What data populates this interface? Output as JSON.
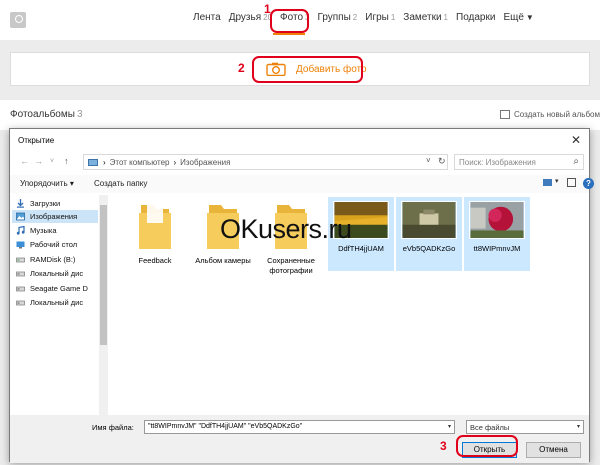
{
  "ok_page": {
    "nav": [
      {
        "label": "Лента",
        "count": ""
      },
      {
        "label": "Друзья",
        "count": "20"
      },
      {
        "label": "Фото",
        "count": "3"
      },
      {
        "label": "Группы",
        "count": "2"
      },
      {
        "label": "Игры",
        "count": "1"
      },
      {
        "label": "Заметки",
        "count": "1"
      },
      {
        "label": "Подарки",
        "count": ""
      },
      {
        "label": "Ещё",
        "count": ""
      }
    ],
    "add_photo_label": "Добавить фото",
    "albums_title": "Фотоальбомы",
    "albums_count": "3",
    "create_album_label": "Создать новый альбом",
    "accent_color": "#ee8208"
  },
  "annotations": {
    "n1": "1",
    "n2": "2",
    "n3": "3",
    "color": "#e0001b"
  },
  "dialog": {
    "title": "Открытие",
    "close_glyph": "✕",
    "breadcrumb": [
      "Этот компьютер",
      "Изображения"
    ],
    "search_placeholder": "Поиск: Изображения",
    "organize_label": "Упорядочить ▾",
    "new_folder_label": "Создать папку",
    "sidebar": [
      {
        "label": "Загрузки",
        "icon": "download-icon"
      },
      {
        "label": "Изображения",
        "icon": "pictures-icon"
      },
      {
        "label": "Музыка",
        "icon": "music-icon"
      },
      {
        "label": "Рабочий стол",
        "icon": "desktop-icon"
      },
      {
        "label": "RAMDisk (B:)",
        "icon": "drive-icon"
      },
      {
        "label": "Локальный дис",
        "icon": "drive-icon"
      },
      {
        "label": "Seagate Game D",
        "icon": "drive-icon"
      },
      {
        "label": "Локальный дис",
        "icon": "drive-icon"
      }
    ],
    "files": [
      {
        "label": "Feedback",
        "kind": "folder"
      },
      {
        "label": "Альбом камеры",
        "kind": "folder"
      },
      {
        "label": "Сохраненные фотографии",
        "kind": "folder"
      },
      {
        "label": "DdfTH4jjUAM",
        "kind": "image"
      },
      {
        "label": "eVb5QADKzGo",
        "kind": "image"
      },
      {
        "label": "tt8WIPmnvJM",
        "kind": "image"
      }
    ],
    "filename_label": "Имя файла:",
    "filename_value": "\"tt8WIPmnvJM\" \"DdfTH4jjUAM\" \"eVb5QADKzGo\"",
    "filetype_value": "Все файлы",
    "open_label": "Открыть",
    "cancel_label": "Отмена"
  },
  "watermark": "OKusers.ru"
}
